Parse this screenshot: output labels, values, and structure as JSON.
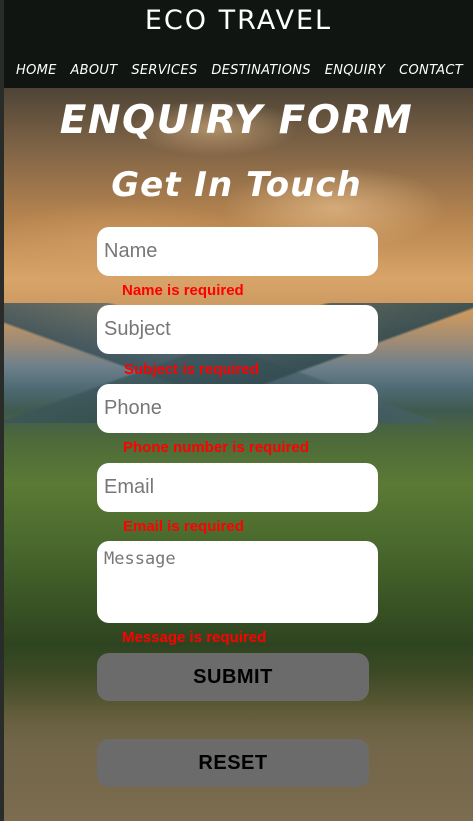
{
  "header": {
    "site_title": "ECO TRAVEL",
    "nav": [
      {
        "label": "HOME"
      },
      {
        "label": "ABOUT"
      },
      {
        "label": "SERVICES"
      },
      {
        "label": "DESTINATIONS"
      },
      {
        "label": "ENQUIRY"
      },
      {
        "label": "CONTACT"
      }
    ]
  },
  "form": {
    "title": "ENQUIRY FORM",
    "subtitle": "Get In Touch",
    "fields": {
      "name": {
        "placeholder": "Name",
        "value": "",
        "error": "Name is required"
      },
      "subject": {
        "placeholder": "Subject",
        "value": "",
        "error": "Subject is required"
      },
      "phone": {
        "placeholder": "Phone",
        "value": "",
        "error": "Phone number is required"
      },
      "email": {
        "placeholder": "Email",
        "value": "",
        "error": "Email is required"
      },
      "message": {
        "placeholder": "Message",
        "value": "",
        "error": "Message is required"
      }
    },
    "submit_label": "SUBMIT",
    "reset_label": "RESET"
  },
  "colors": {
    "header_bg": "#101512",
    "error": "#ff0000",
    "button_bg": "#6b6b6b",
    "field_bg": "#ffffff"
  }
}
